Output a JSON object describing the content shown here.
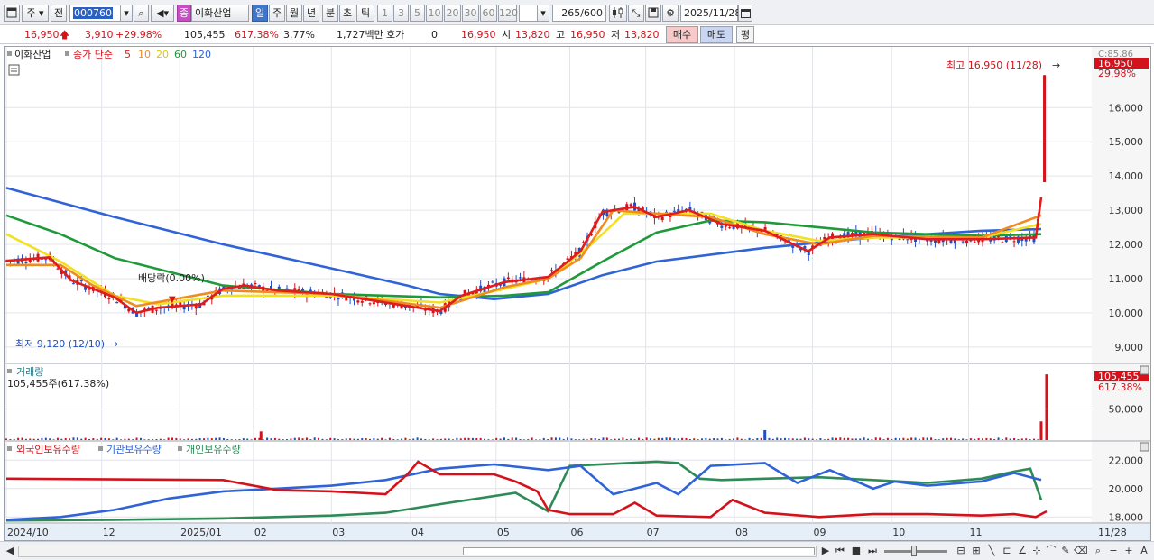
{
  "toolbar": {
    "market_label": "주",
    "prev_label": "전",
    "stock_code": "000760",
    "stock_name": "이화산업",
    "stock_prefix": "종",
    "period_tabs": [
      "일",
      "주",
      "월",
      "년",
      "분",
      "초",
      "틱"
    ],
    "active_period": "일",
    "interval_buttons": [
      "1",
      "3",
      "5",
      "10",
      "20",
      "30",
      "60",
      "120"
    ],
    "count_value": "265",
    "count_total": "/600",
    "date_value": "2025/11/28"
  },
  "quote": {
    "price": "16,950",
    "change": "3,910",
    "change_pct": "+29.98%",
    "volume": "105,455",
    "volume_ratio": "617.38%",
    "turnover": "3.77%",
    "trade_value": "1,727백만",
    "hoga_label": "호가",
    "hoga_value": "0",
    "hoga_price": "16,950",
    "open_label": "시",
    "open_value": "13,820",
    "high_label": "고",
    "high_value": "16,950",
    "low_label": "저",
    "low_value": "13,820",
    "buy_label": "매수",
    "sell_label": "매도",
    "simple_label": "평"
  },
  "colors": {
    "up": "#d3121b",
    "down": "#1f4fc7",
    "ma5": "#e21c1c",
    "ma10": "#f08c1e",
    "ma20": "#f2e022",
    "ma60": "#1f9a3a",
    "ma120": "#2f63d6",
    "foreign": "#d3121b",
    "institution": "#2f63d6",
    "individual": "#2e8b57"
  },
  "chart_data": [
    {
      "type": "candlestick",
      "title": "이화산업",
      "legend": [
        "종가 단순",
        "5",
        "10",
        "20",
        "60",
        "120"
      ],
      "ylim": [
        8600,
        17300
      ],
      "y_ticks": [
        "16,000",
        "15,000",
        "14,000",
        "13,000",
        "12,000",
        "11,000",
        "10,000",
        "9,000"
      ],
      "ma_series": [
        {
          "name": "5",
          "values": [
            [
              0,
              11520
            ],
            [
              0.04,
              11620
            ],
            [
              0.06,
              10950
            ],
            [
              0.08,
              10700
            ],
            [
              0.1,
              10450
            ],
            [
              0.12,
              10000
            ],
            [
              0.14,
              10150
            ],
            [
              0.18,
              10250
            ],
            [
              0.2,
              10700
            ],
            [
              0.22,
              10800
            ],
            [
              0.25,
              10650
            ],
            [
              0.3,
              10550
            ],
            [
              0.33,
              10400
            ],
            [
              0.37,
              10200
            ],
            [
              0.4,
              10050
            ],
            [
              0.42,
              10500
            ],
            [
              0.46,
              10900
            ],
            [
              0.5,
              11050
            ],
            [
              0.53,
              11800
            ],
            [
              0.55,
              12950
            ],
            [
              0.58,
              13100
            ],
            [
              0.6,
              12800
            ],
            [
              0.63,
              13000
            ],
            [
              0.66,
              12600
            ],
            [
              0.7,
              12400
            ],
            [
              0.74,
              11800
            ],
            [
              0.76,
              12200
            ],
            [
              0.8,
              12300
            ],
            [
              0.85,
              12150
            ],
            [
              0.9,
              12150
            ],
            [
              0.95,
              12200
            ],
            [
              0.955,
              13380
            ]
          ]
        },
        {
          "name": "10",
          "values": [
            [
              0,
              11400
            ],
            [
              0.05,
              11400
            ],
            [
              0.08,
              10800
            ],
            [
              0.12,
              10200
            ],
            [
              0.2,
              10650
            ],
            [
              0.3,
              10550
            ],
            [
              0.4,
              10150
            ],
            [
              0.46,
              10750
            ],
            [
              0.5,
              11000
            ],
            [
              0.53,
              11600
            ],
            [
              0.56,
              13000
            ],
            [
              0.6,
              12900
            ],
            [
              0.65,
              12800
            ],
            [
              0.7,
              12300
            ],
            [
              0.75,
              12000
            ],
            [
              0.8,
              12250
            ],
            [
              0.9,
              12200
            ],
            [
              0.955,
              12850
            ]
          ]
        },
        {
          "name": "20",
          "values": [
            [
              0,
              12300
            ],
            [
              0.05,
              11500
            ],
            [
              0.1,
              10500
            ],
            [
              0.14,
              10250
            ],
            [
              0.2,
              10500
            ],
            [
              0.3,
              10500
            ],
            [
              0.4,
              10300
            ],
            [
              0.46,
              10700
            ],
            [
              0.5,
              11000
            ],
            [
              0.54,
              12000
            ],
            [
              0.57,
              12900
            ],
            [
              0.65,
              12900
            ],
            [
              0.7,
              12400
            ],
            [
              0.75,
              12100
            ],
            [
              0.8,
              12200
            ],
            [
              0.9,
              12200
            ],
            [
              0.955,
              12600
            ]
          ]
        },
        {
          "name": "60",
          "values": [
            [
              0,
              12850
            ],
            [
              0.05,
              12300
            ],
            [
              0.1,
              11600
            ],
            [
              0.2,
              10800
            ],
            [
              0.3,
              10550
            ],
            [
              0.4,
              10450
            ],
            [
              0.46,
              10500
            ],
            [
              0.5,
              10600
            ],
            [
              0.55,
              11500
            ],
            [
              0.6,
              12350
            ],
            [
              0.65,
              12700
            ],
            [
              0.7,
              12650
            ],
            [
              0.8,
              12350
            ],
            [
              0.9,
              12250
            ],
            [
              0.955,
              12300
            ]
          ]
        },
        {
          "name": "120",
          "values": [
            [
              0,
              13650
            ],
            [
              0.1,
              12800
            ],
            [
              0.2,
              12000
            ],
            [
              0.3,
              11300
            ],
            [
              0.37,
              10800
            ],
            [
              0.4,
              10550
            ],
            [
              0.45,
              10400
            ],
            [
              0.5,
              10550
            ],
            [
              0.55,
              11100
            ],
            [
              0.6,
              11500
            ],
            [
              0.7,
              11900
            ],
            [
              0.8,
              12200
            ],
            [
              0.9,
              12400
            ],
            [
              0.955,
              12450
            ]
          ]
        }
      ],
      "annotations": [
        {
          "text": "최고 16,950 (11/28)",
          "x": 0.955,
          "y": 16950
        },
        {
          "text": "최저 9,120 (12/10)",
          "x": 0.11,
          "y": 9120
        },
        {
          "text": "배당락(0.00%)",
          "x": 0.15,
          "y": 10900
        }
      ],
      "current_price": "16,950",
      "current_pct": "29.98%",
      "c_label": "C:85.86"
    },
    {
      "type": "bar",
      "title": "거래량",
      "subtitle": "105,455주(617.38%)",
      "y_ticks": [
        "50,000"
      ],
      "ylim": [
        0,
        110000
      ],
      "spikes": [
        [
          0.235,
          14000
        ],
        [
          0.7,
          16000
        ],
        [
          0.955,
          30000
        ],
        [
          0.96,
          105455
        ]
      ],
      "current_value": "105,455",
      "current_pct": "617.38%"
    },
    {
      "type": "line",
      "legend": [
        "외국인보유수량",
        "기관보유수량",
        "개인보유수량"
      ],
      "y_ticks": [
        "22,000",
        "20,000",
        "18,000"
      ],
      "ylim": [
        17700,
        22400
      ],
      "series": [
        {
          "name": "외국인보유수량",
          "values": [
            [
              0,
              20700
            ],
            [
              0.1,
              20650
            ],
            [
              0.2,
              20600
            ],
            [
              0.25,
              19900
            ],
            [
              0.3,
              19800
            ],
            [
              0.35,
              19600
            ],
            [
              0.37,
              21000
            ],
            [
              0.38,
              21900
            ],
            [
              0.4,
              21000
            ],
            [
              0.45,
              21000
            ],
            [
              0.47,
              20500
            ],
            [
              0.49,
              19800
            ],
            [
              0.5,
              18500
            ],
            [
              0.52,
              18200
            ],
            [
              0.56,
              18200
            ],
            [
              0.58,
              19000
            ],
            [
              0.6,
              18100
            ],
            [
              0.65,
              18000
            ],
            [
              0.67,
              19200
            ],
            [
              0.7,
              18300
            ],
            [
              0.75,
              18000
            ],
            [
              0.8,
              18200
            ],
            [
              0.85,
              18200
            ],
            [
              0.9,
              18100
            ],
            [
              0.93,
              18200
            ],
            [
              0.95,
              18000
            ],
            [
              0.96,
              18400
            ]
          ]
        },
        {
          "name": "기관보유수량",
          "values": [
            [
              0,
              17800
            ],
            [
              0.05,
              18000
            ],
            [
              0.1,
              18500
            ],
            [
              0.15,
              19300
            ],
            [
              0.2,
              19800
            ],
            [
              0.25,
              20000
            ],
            [
              0.3,
              20200
            ],
            [
              0.35,
              20600
            ],
            [
              0.4,
              21400
            ],
            [
              0.45,
              21700
            ],
            [
              0.5,
              21300
            ],
            [
              0.53,
              21600
            ],
            [
              0.56,
              19600
            ],
            [
              0.6,
              20400
            ],
            [
              0.62,
              19600
            ],
            [
              0.65,
              21600
            ],
            [
              0.7,
              21800
            ],
            [
              0.73,
              20400
            ],
            [
              0.76,
              21300
            ],
            [
              0.8,
              20000
            ],
            [
              0.82,
              20500
            ],
            [
              0.85,
              20200
            ],
            [
              0.9,
              20500
            ],
            [
              0.93,
              21100
            ],
            [
              0.955,
              20600
            ]
          ]
        },
        {
          "name": "개인보유수량",
          "values": [
            [
              0,
              17750
            ],
            [
              0.1,
              17800
            ],
            [
              0.2,
              17900
            ],
            [
              0.3,
              18100
            ],
            [
              0.35,
              18300
            ],
            [
              0.4,
              18900
            ],
            [
              0.47,
              19700
            ],
            [
              0.5,
              18400
            ],
            [
              0.52,
              21600
            ],
            [
              0.6,
              21900
            ],
            [
              0.62,
              21800
            ],
            [
              0.64,
              20700
            ],
            [
              0.66,
              20600
            ],
            [
              0.7,
              20700
            ],
            [
              0.75,
              20800
            ],
            [
              0.8,
              20600
            ],
            [
              0.85,
              20400
            ],
            [
              0.9,
              20700
            ],
            [
              0.93,
              21200
            ],
            [
              0.945,
              21400
            ],
            [
              0.955,
              19200
            ]
          ]
        }
      ]
    }
  ],
  "x_axis": {
    "labels": [
      "2024/10",
      "12",
      "2025/01",
      "02",
      "03",
      "04",
      "05",
      "06",
      "07",
      "08",
      "09",
      "10",
      "11",
      "11/28"
    ]
  }
}
